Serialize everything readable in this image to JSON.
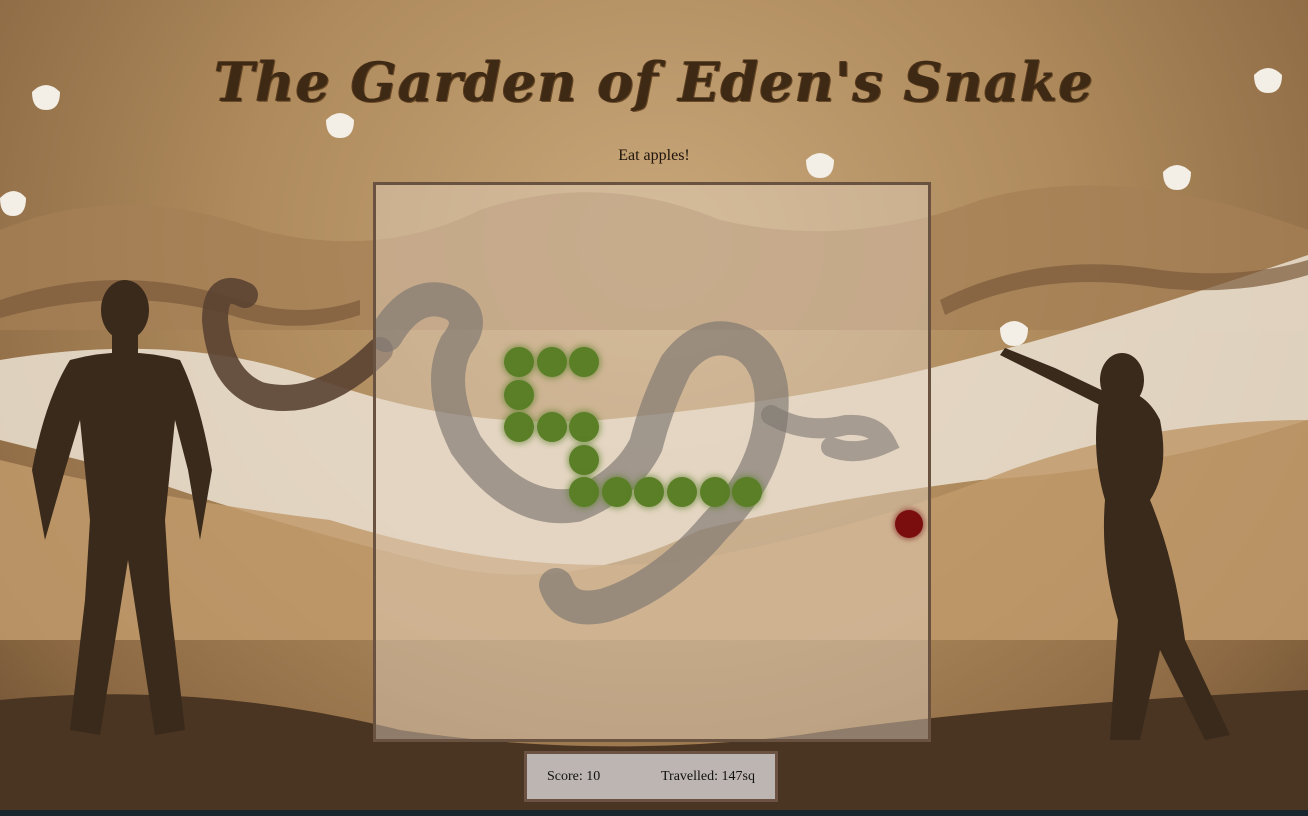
{
  "game": {
    "title": "The Garden of Eden's Snake",
    "instruction": "Eat apples!"
  },
  "status": {
    "score": "Score: 10",
    "travelled": "Travelled: 147sq"
  },
  "colors": {
    "snake": "#5a7f27",
    "apple": "#7a0e0e",
    "board_border": "#6a5240",
    "title": "#3e2914"
  },
  "snake": {
    "body": [
      {
        "col": 0,
        "row": 0
      },
      {
        "col": 1,
        "row": 0
      },
      {
        "col": 2,
        "row": 0
      },
      {
        "col": 0,
        "row": 1
      },
      {
        "col": 0,
        "row": 2
      },
      {
        "col": 1,
        "row": 2
      },
      {
        "col": 2,
        "row": 2
      },
      {
        "col": 2,
        "row": 3
      },
      {
        "col": 2,
        "row": 4
      },
      {
        "col": 3,
        "row": 4
      },
      {
        "col": 4,
        "row": 4
      },
      {
        "col": 5,
        "row": 4
      },
      {
        "col": 6,
        "row": 4
      },
      {
        "col": 7,
        "row": 4
      }
    ]
  },
  "apple": {
    "col": 12,
    "row": 5
  }
}
